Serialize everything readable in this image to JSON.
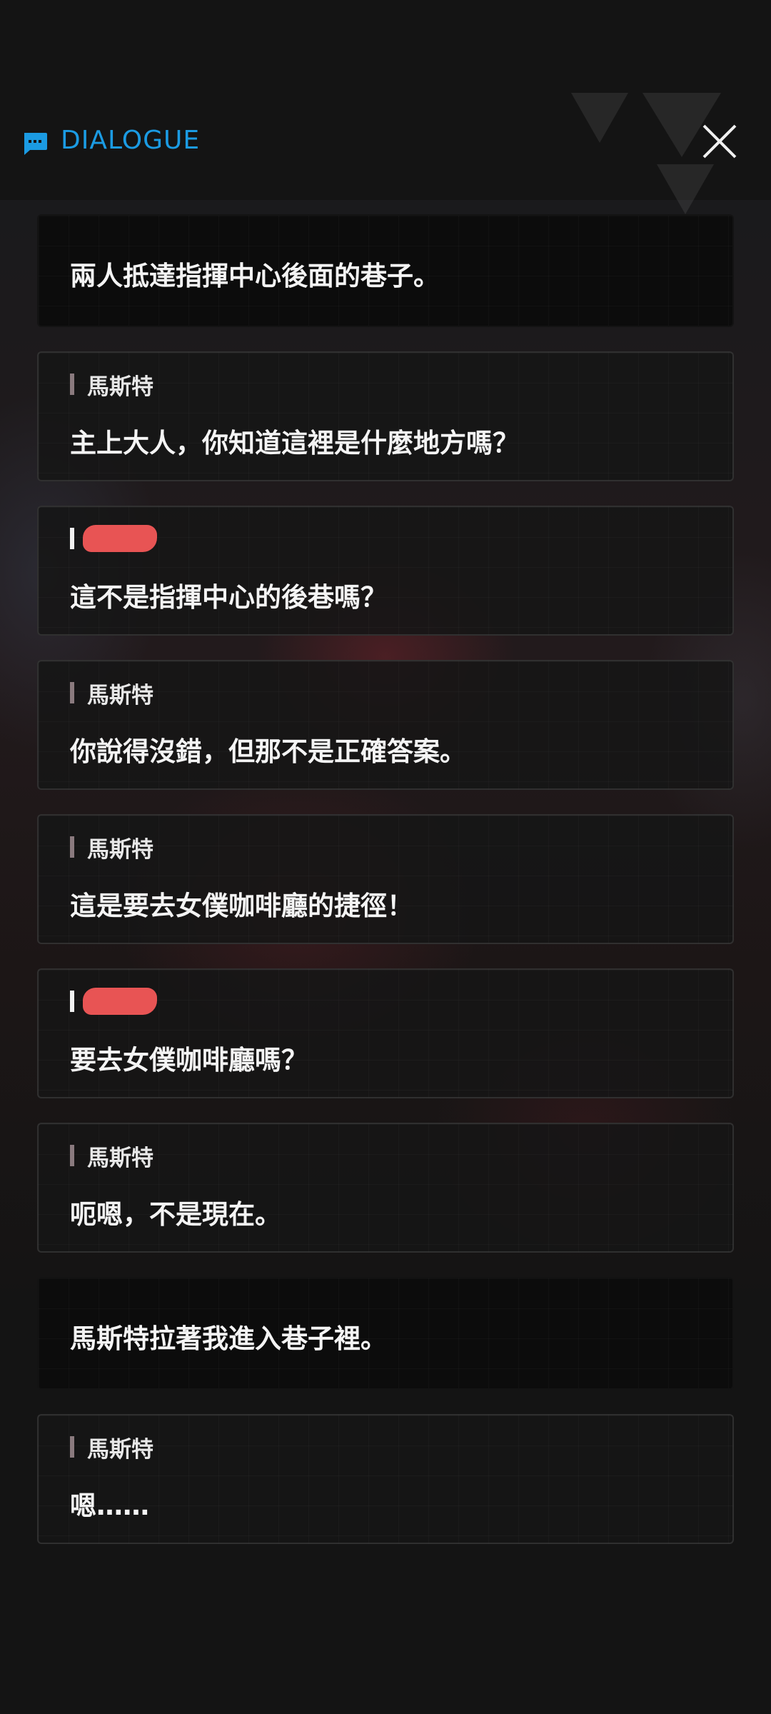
{
  "header": {
    "title": "DIALOGUE",
    "icon": "chat-icon",
    "accent_color": "#1b9be3",
    "close_icon": "close-icon"
  },
  "dialogue": [
    {
      "type": "narration",
      "text": "兩人抵達指揮中心後面的巷子。"
    },
    {
      "type": "speech",
      "speaker": "馬斯特",
      "text": "主上大人，你知道這裡是什麼地方嗎？"
    },
    {
      "type": "speech",
      "speaker": "",
      "redacted": true,
      "text": "這不是指揮中心的後巷嗎？"
    },
    {
      "type": "speech",
      "speaker": "馬斯特",
      "text": "你說得沒錯，但那不是正確答案。"
    },
    {
      "type": "speech",
      "speaker": "馬斯特",
      "text": "這是要去女僕咖啡廳的捷徑！"
    },
    {
      "type": "speech",
      "speaker": "",
      "redacted": true,
      "text": "要去女僕咖啡廳嗎？"
    },
    {
      "type": "speech",
      "speaker": "馬斯特",
      "text": "呃嗯，不是現在。"
    },
    {
      "type": "narration",
      "text": "馬斯特拉著我進入巷子裡。"
    },
    {
      "type": "speech",
      "speaker": "馬斯特",
      "text": "嗯……"
    }
  ]
}
